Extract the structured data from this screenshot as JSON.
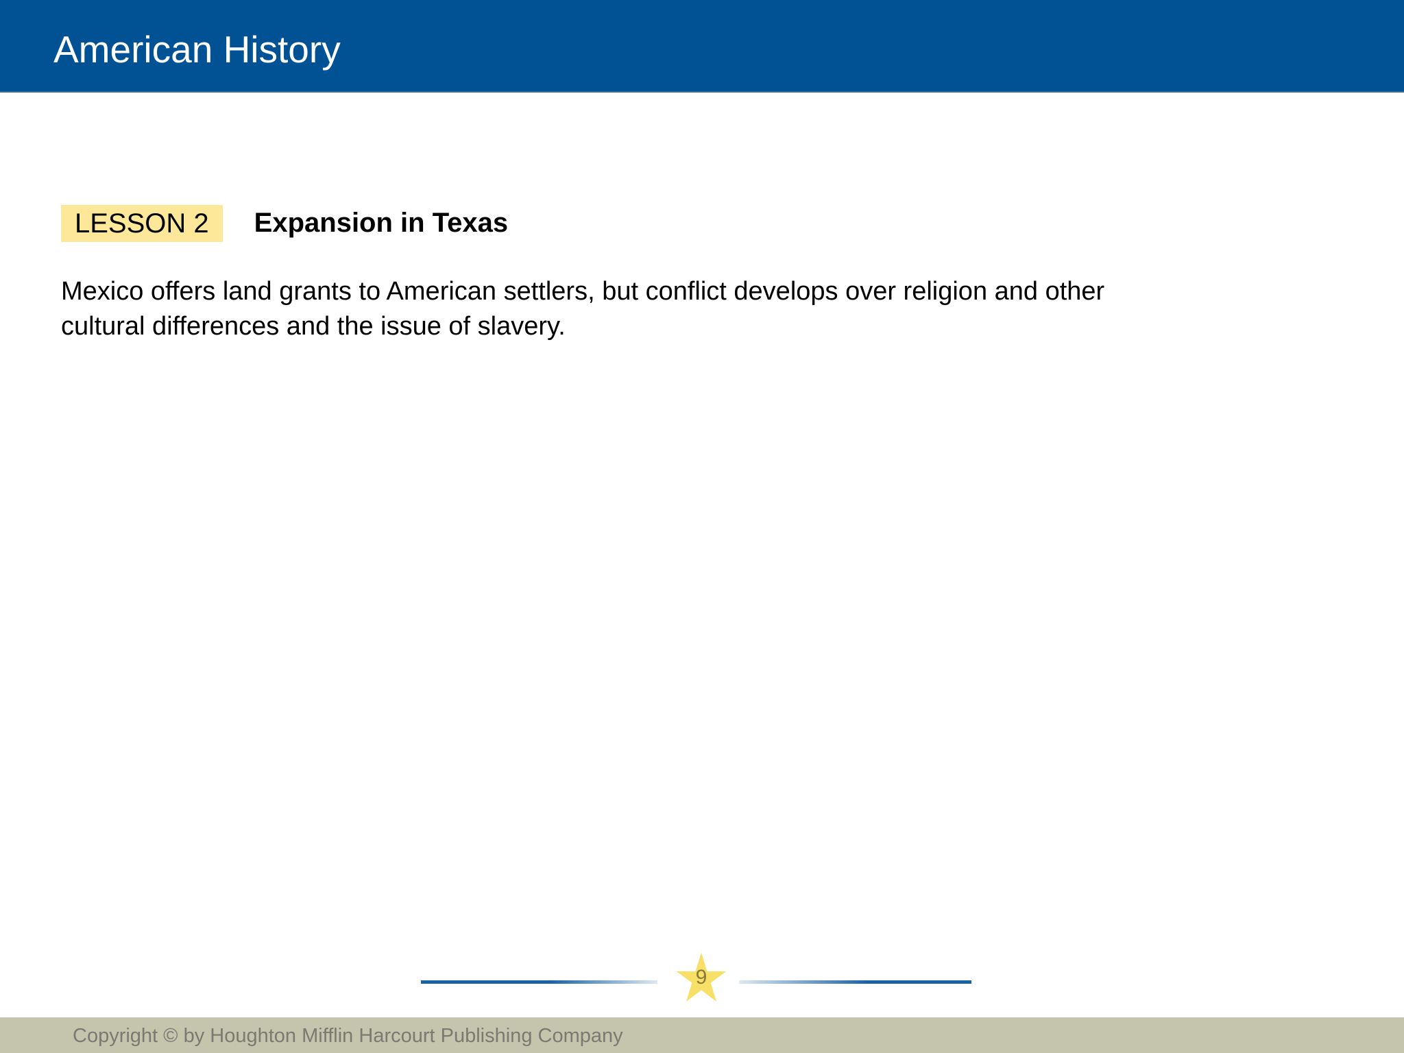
{
  "header": {
    "title": "American History"
  },
  "lesson": {
    "badge": "LESSON 2",
    "title": "Expansion in Texas",
    "summary": "Mexico offers land grants to American settlers, but conflict develops over religion and other cultural differences and the issue of slavery."
  },
  "page": {
    "number": "9",
    "icon": "star-icon"
  },
  "footer": {
    "copyright": "Copyright © by Houghton Mifflin Harcourt Publishing Company"
  },
  "colors": {
    "header_bg": "#005295",
    "badge_bg": "#fde89a",
    "footer_bg": "#c5c4ad",
    "star": "#f7d94c",
    "rule": "#1a64a6"
  }
}
